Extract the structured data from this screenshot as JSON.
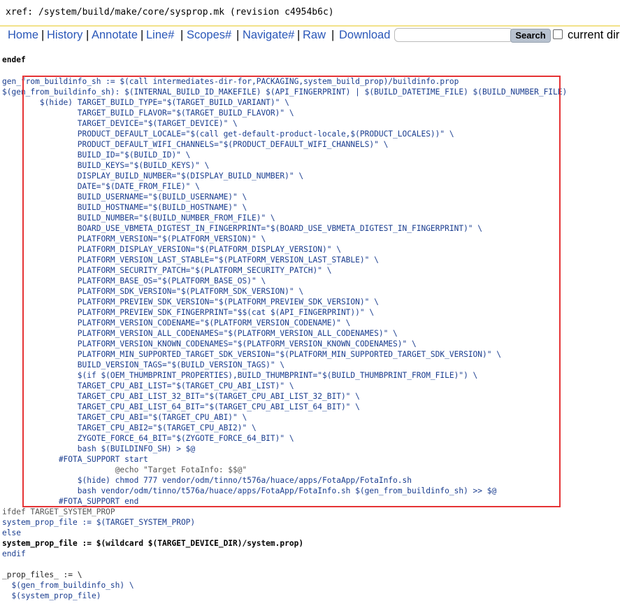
{
  "header": {
    "title": "xref: /system/build/make/core/sysprop.mk (revision c4954b6c)"
  },
  "nav": {
    "items": [
      "Home",
      "History",
      "Annotate",
      "Line#",
      "Scopes#",
      "Navigate#",
      "Raw",
      "Download"
    ],
    "search_placeholder": "",
    "search_button": "Search",
    "current_dir_label": "current dir"
  },
  "code": {
    "lines": [
      "",
      "endef",
      "",
      "gen_from_buildinfo_sh := $(call intermediates-dir-for,PACKAGING,system_build_prop)/buildinfo.prop",
      "$(gen_from_buildinfo_sh): $(INTERNAL_BUILD_ID_MAKEFILE) $(API_FINGERPRINT) | $(BUILD_DATETIME_FILE) $(BUILD_NUMBER_FILE)",
      "        $(hide) TARGET_BUILD_TYPE=\"$(TARGET_BUILD_VARIANT)\" \\",
      "                TARGET_BUILD_FLAVOR=\"$(TARGET_BUILD_FLAVOR)\" \\",
      "                TARGET_DEVICE=\"$(TARGET_DEVICE)\" \\",
      "                PRODUCT_DEFAULT_LOCALE=\"$(call get-default-product-locale,$(PRODUCT_LOCALES))\" \\",
      "                PRODUCT_DEFAULT_WIFI_CHANNELS=\"$(PRODUCT_DEFAULT_WIFI_CHANNELS)\" \\",
      "                BUILD_ID=\"$(BUILD_ID)\" \\",
      "                BUILD_KEYS=\"$(BUILD_KEYS)\" \\",
      "                DISPLAY_BUILD_NUMBER=\"$(DISPLAY_BUILD_NUMBER)\" \\",
      "                DATE=\"$(DATE_FROM_FILE)\" \\",
      "                BUILD_USERNAME=\"$(BUILD_USERNAME)\" \\",
      "                BUILD_HOSTNAME=\"$(BUILD_HOSTNAME)\" \\",
      "                BUILD_NUMBER=\"$(BUILD_NUMBER_FROM_FILE)\" \\",
      "                BOARD_USE_VBMETA_DIGTEST_IN_FINGERPRINT=\"$(BOARD_USE_VBMETA_DIGTEST_IN_FINGERPRINT)\" \\",
      "                PLATFORM_VERSION=\"$(PLATFORM_VERSION)\" \\",
      "                PLATFORM_DISPLAY_VERSION=\"$(PLATFORM_DISPLAY_VERSION)\" \\",
      "                PLATFORM_VERSION_LAST_STABLE=\"$(PLATFORM_VERSION_LAST_STABLE)\" \\",
      "                PLATFORM_SECURITY_PATCH=\"$(PLATFORM_SECURITY_PATCH)\" \\",
      "                PLATFORM_BASE_OS=\"$(PLATFORM_BASE_OS)\" \\",
      "                PLATFORM_SDK_VERSION=\"$(PLATFORM_SDK_VERSION)\" \\",
      "                PLATFORM_PREVIEW_SDK_VERSION=\"$(PLATFORM_PREVIEW_SDK_VERSION)\" \\",
      "                PLATFORM_PREVIEW_SDK_FINGERPRINT=\"$$(cat $(API_FINGERPRINT))\" \\",
      "                PLATFORM_VERSION_CODENAME=\"$(PLATFORM_VERSION_CODENAME)\" \\",
      "                PLATFORM_VERSION_ALL_CODENAMES=\"$(PLATFORM_VERSION_ALL_CODENAMES)\" \\",
      "                PLATFORM_VERSION_KNOWN_CODENAMES=\"$(PLATFORM_VERSION_KNOWN_CODENAMES)\" \\",
      "                PLATFORM_MIN_SUPPORTED_TARGET_SDK_VERSION=\"$(PLATFORM_MIN_SUPPORTED_TARGET_SDK_VERSION)\" \\",
      "                BUILD_VERSION_TAGS=\"$(BUILD_VERSION_TAGS)\" \\",
      "                $(if $(OEM_THUMBPRINT_PROPERTIES),BUILD_THUMBPRINT=\"$(BUILD_THUMBPRINT_FROM_FILE)\") \\",
      "                TARGET_CPU_ABI_LIST=\"$(TARGET_CPU_ABI_LIST)\" \\",
      "                TARGET_CPU_ABI_LIST_32_BIT=\"$(TARGET_CPU_ABI_LIST_32_BIT)\" \\",
      "                TARGET_CPU_ABI_LIST_64_BIT=\"$(TARGET_CPU_ABI_LIST_64_BIT)\" \\",
      "                TARGET_CPU_ABI=\"$(TARGET_CPU_ABI)\" \\",
      "                TARGET_CPU_ABI2=\"$(TARGET_CPU_ABI2)\" \\",
      "                ZYGOTE_FORCE_64_BIT=\"$(ZYGOTE_FORCE_64_BIT)\" \\",
      "                bash $(BUILDINFO_SH) > $@",
      "            #FOTA_SUPPORT start",
      "                        @echo \"Target FotaInfo: $$@\"",
      "                $(hide) chmod 777 vendor/odm/tinno/t576a/huace/apps/FotaApp/FotaInfo.sh",
      "                bash vendor/odm/tinno/t576a/huace/apps/FotaApp/FotaInfo.sh $(gen_from_buildinfo_sh) >> $@",
      "            #FOTA_SUPPORT end",
      "ifdef TARGET_SYSTEM_PROP",
      "system_prop_file := $(TARGET_SYSTEM_PROP)",
      "else",
      "system_prop_file := $(wildcard $(TARGET_DEVICE_DIR)/system.prop)",
      "endif",
      "",
      "_prop_files_ := \\",
      "  $(gen_from_buildinfo_sh) \\",
      "  $(system_prop_file)"
    ]
  }
}
